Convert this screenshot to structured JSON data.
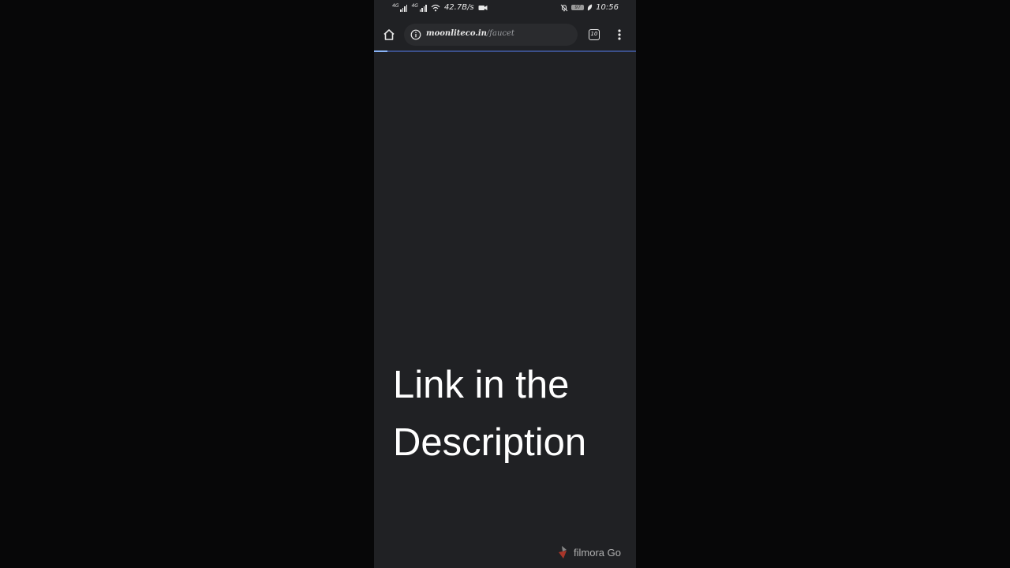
{
  "status_bar": {
    "net_label_1": "4G",
    "net_label_2": "4G",
    "speed": "42.7B/s",
    "battery": "97",
    "time": "10:56"
  },
  "browser": {
    "url_host": "moonliteco.in",
    "url_path": "/faucet",
    "tab_count": "10",
    "load_progress": 0.05
  },
  "content": {
    "caption_line_1": "Link in the",
    "caption_line_2": "Description"
  },
  "watermark": {
    "text": "filmora Go"
  },
  "colors": {
    "page_bg": "#202124",
    "outer_bg": "#070708",
    "progress": "#8ab4f8"
  }
}
